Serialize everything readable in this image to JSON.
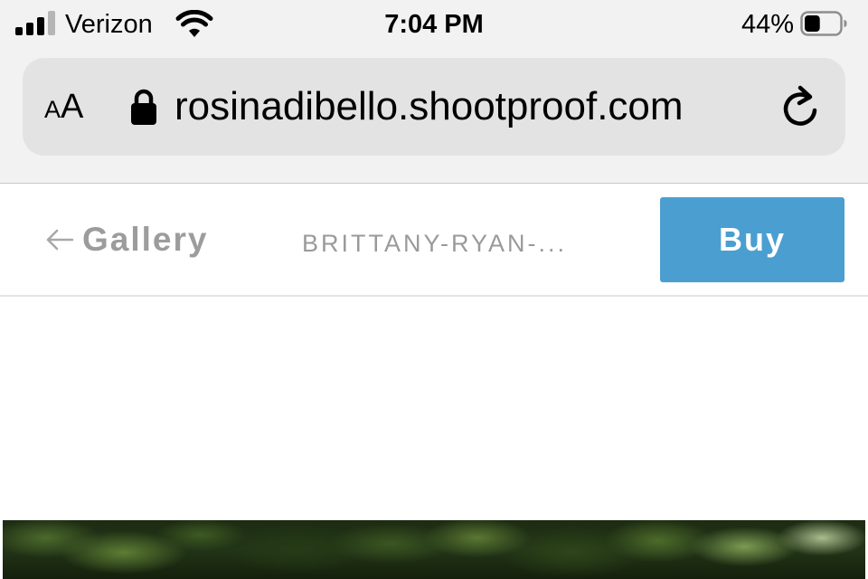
{
  "status_bar": {
    "carrier": "Verizon",
    "time": "7:04 PM",
    "battery_percent": "44%",
    "battery_level": 0.44,
    "signal_bars_active": 3,
    "signal_bars_total": 4,
    "icons": [
      "signal-icon",
      "wifi-icon",
      "battery-icon"
    ]
  },
  "address_bar": {
    "text_size_small": "A",
    "text_size_big": "A",
    "url": "rosinadibello.shootproof.com",
    "icons": [
      "lock-icon",
      "reload-icon"
    ]
  },
  "header": {
    "back_label": "Gallery",
    "album_title": "BRITTANY-RYAN-...",
    "buy_label": "Buy",
    "icons": [
      "back-arrow-icon"
    ]
  },
  "colors": {
    "buy_button": "#4a9fd0",
    "chrome_background": "#f2f2f2",
    "address_bar_background": "#e3e3e3",
    "muted_text": "#9c9c9c"
  }
}
